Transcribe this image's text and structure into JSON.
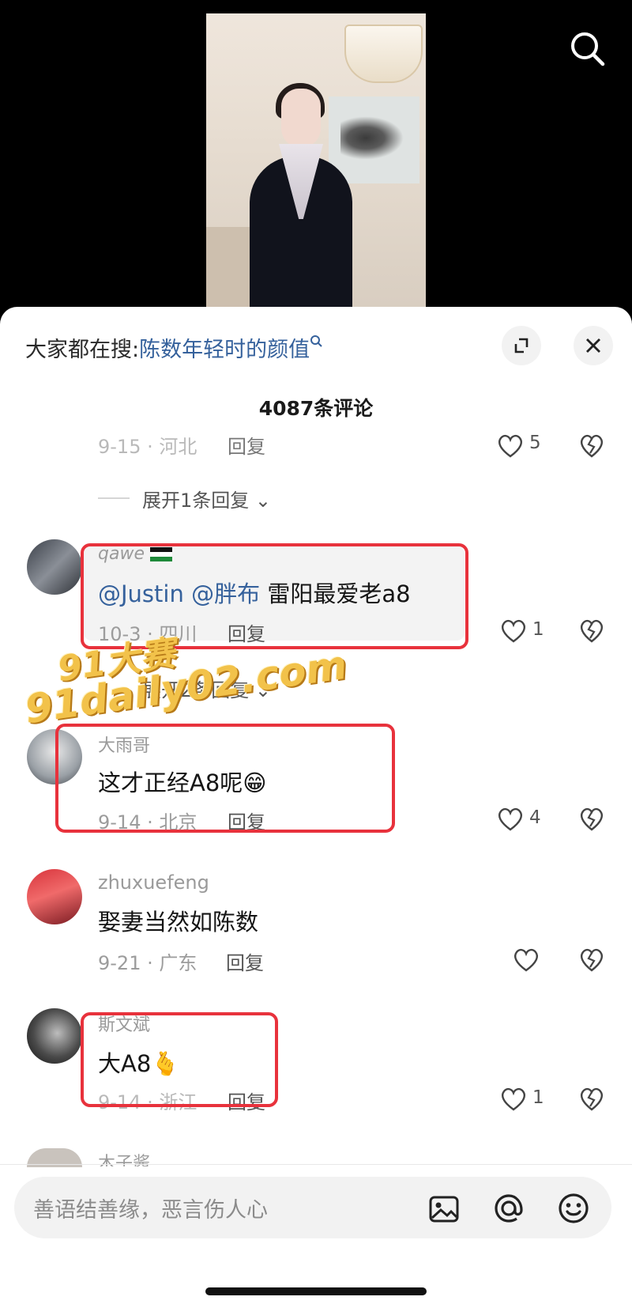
{
  "header": {
    "hot_search_prefix": "大家都在搜:",
    "hot_search_keyword": "陈数年轻时的颜值",
    "comment_count": "4087条评论"
  },
  "comments": [
    {
      "meta": "9-15 · 河北",
      "reply": "回复",
      "likes": "5",
      "expand": "展开1条回复"
    },
    {
      "user": "qawe",
      "mention1": "@Justin",
      "mention2": "@胖布",
      "text": "雷阳最爱老a8",
      "meta": "10-3 · 四川",
      "reply": "回复",
      "likes": "1",
      "expand": "展开2条回复"
    },
    {
      "user": "大雨哥",
      "text": "这才正经A8呢😁",
      "meta": "9-14 · 北京",
      "reply": "回复",
      "likes": "4"
    },
    {
      "user": "zhuxuefeng",
      "text": "娶妻当然如陈数",
      "meta": "9-21 · 广东",
      "reply": "回复",
      "likes": ""
    },
    {
      "user": "斯文斌",
      "text": "大A8🫰",
      "meta": "9-14 · 浙江",
      "reply": "回复",
      "likes": "1"
    },
    {
      "user": "木子酱"
    }
  ],
  "watermark": {
    "line1": "91大赛",
    "line2": "91daily02.com"
  },
  "input": {
    "placeholder": "善语结善缘，恶言伤人心"
  },
  "icons": [
    "search-icon",
    "expand-icon",
    "close-icon",
    "heart-icon",
    "broken-heart-icon",
    "image-icon",
    "at-icon",
    "emoji-icon"
  ]
}
